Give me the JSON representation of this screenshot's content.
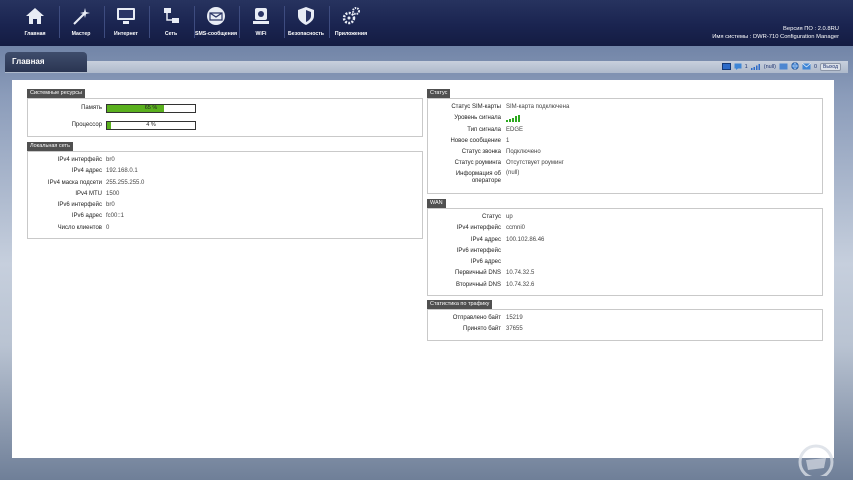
{
  "nav": [
    {
      "label": "Главная",
      "icon": "home-icon"
    },
    {
      "label": "Мастер",
      "icon": "wizard-icon"
    },
    {
      "label": "Интернет",
      "icon": "monitor-icon"
    },
    {
      "label": "Сеть",
      "icon": "network-icon"
    },
    {
      "label": "SMS-сообщения",
      "icon": "envelope-icon"
    },
    {
      "label": "WiFi",
      "icon": "wifi-router-icon"
    },
    {
      "label": "Безопасность",
      "icon": "shield-icon"
    },
    {
      "label": "Приложения",
      "icon": "gears-icon"
    }
  ],
  "header": {
    "firmware": "Версия ПО : 2.0.8RU",
    "system_name": "Имя системы : DWR-710 Configuration Manager"
  },
  "page_tab": "Главная",
  "toolbar": {
    "sms_count": "1",
    "signal_text": "(null)",
    "mail_count": "0",
    "logout": "Выход"
  },
  "system_resources": {
    "title": "Системные ресурсы",
    "memory_label": "Память",
    "memory_value": "65 %",
    "memory_fraction": 0.65,
    "cpu_label": "Процессор",
    "cpu_value": "4 %",
    "cpu_fraction": 0.04
  },
  "lan": {
    "title": "Локальная сеть",
    "rows": [
      {
        "k": "IPv4 интерфейс",
        "v": "br0"
      },
      {
        "k": "IPv4 адрес",
        "v": "192.168.0.1"
      },
      {
        "k": "IPv4 маска подсети",
        "v": "255.255.255.0"
      },
      {
        "k": "IPv4 MTU",
        "v": "1500"
      },
      {
        "k": "IPv6 интерфейс",
        "v": "br0"
      },
      {
        "k": "IPv6 адрес",
        "v": "fc00::1"
      },
      {
        "k": "Число клиентов",
        "v": "0"
      }
    ]
  },
  "status": {
    "title": "Статус",
    "rows": [
      {
        "k": "Статус SIM-карты",
        "v": "SIM-карта подключена"
      },
      {
        "k": "Уровень сигнала",
        "v": ""
      },
      {
        "k": "Тип сигнала",
        "v": "EDGE"
      },
      {
        "k": "Новое сообщение",
        "v": "1"
      },
      {
        "k": "Статус звонка",
        "v": "Подключено"
      },
      {
        "k": "Статус роуминга",
        "v": "Отсутствует роуминг"
      }
    ],
    "operator_k1": "Информация об",
    "operator_k2": "операторе",
    "operator_v": "(null)",
    "signal_bars": 5
  },
  "wan": {
    "title": "WAN",
    "rows": [
      {
        "k": "Статус",
        "v": "up"
      },
      {
        "k": "IPv4 интерфейс",
        "v": "ccmni0"
      },
      {
        "k": "IPv4 адрес",
        "v": "100.102.86.46"
      },
      {
        "k": "IPv6 интерфейс",
        "v": ""
      },
      {
        "k": "IPv6 адрес",
        "v": ""
      },
      {
        "k": "Первичный DNS",
        "v": "10.74.32.5"
      },
      {
        "k": "Вторичный DNS",
        "v": "10.74.32.6"
      }
    ]
  },
  "traffic": {
    "title": "Статистика по трафику",
    "rows": [
      {
        "k": "Отправлено байт",
        "v": "15219"
      },
      {
        "k": "Принято байт",
        "v": "37655"
      }
    ]
  }
}
